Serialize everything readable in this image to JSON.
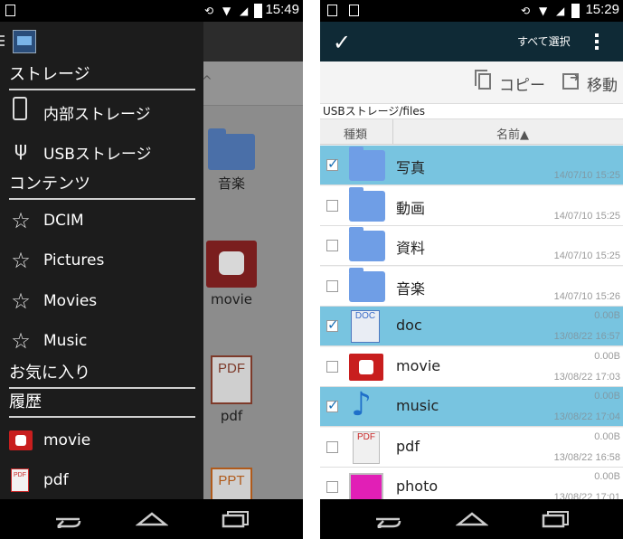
{
  "left": {
    "status": {
      "time": "15:49"
    },
    "drawer": {
      "sections": [
        {
          "title": "ストレージ",
          "items": [
            {
              "label": "内部ストレージ",
              "icon": "phone-icon"
            },
            {
              "label": "USBストレージ",
              "icon": "usb-icon"
            }
          ]
        },
        {
          "title": "コンテンツ",
          "items": [
            {
              "label": "DCIM",
              "icon": "star-icon"
            },
            {
              "label": "Pictures",
              "icon": "star-icon"
            },
            {
              "label": "Movies",
              "icon": "star-icon"
            },
            {
              "label": "Music",
              "icon": "star-icon"
            }
          ]
        },
        {
          "title": "お気に入り",
          "items": []
        },
        {
          "title": "履歴",
          "items": [
            {
              "label": "movie",
              "icon": "film-icon"
            },
            {
              "label": "pdf",
              "icon": "pdf-icon"
            }
          ]
        }
      ],
      "pdf_icon_text": "PDF"
    },
    "background": {
      "chevron": "^",
      "items": [
        {
          "label": "音楽",
          "icon": "folder-icon"
        },
        {
          "label": "movie",
          "icon": "film-icon"
        },
        {
          "label": "pdf",
          "icon": "pdf-icon",
          "icon_text": "PDF"
        },
        {
          "label": "",
          "icon": "ppt-icon",
          "icon_text": "PPT"
        }
      ]
    }
  },
  "right": {
    "status": {
      "time": "15:29"
    },
    "toolbar": {
      "select_all": "すべて選択"
    },
    "actions": {
      "copy": "コピー",
      "move": "移動"
    },
    "path": "USBストレージ/files",
    "columns": {
      "type": "種類",
      "name": "名前▲"
    },
    "files": [
      {
        "name": "写真",
        "type": "folder",
        "size": "",
        "date": "14/07/10 15:25",
        "checked": true
      },
      {
        "name": "動画",
        "type": "folder",
        "size": "",
        "date": "14/07/10 15:25",
        "checked": false
      },
      {
        "name": "資料",
        "type": "folder",
        "size": "",
        "date": "14/07/10 15:25",
        "checked": false
      },
      {
        "name": "音楽",
        "type": "folder",
        "size": "",
        "date": "14/07/10 15:26",
        "checked": false
      },
      {
        "name": "doc",
        "type": "doc",
        "size": "0.00B",
        "date": "13/08/22 16:57",
        "checked": true
      },
      {
        "name": "movie",
        "type": "movie",
        "size": "0.00B",
        "date": "13/08/22 17:03",
        "checked": false
      },
      {
        "name": "music",
        "type": "music",
        "size": "0.00B",
        "date": "13/08/22 17:04",
        "checked": true
      },
      {
        "name": "pdf",
        "type": "pdf",
        "size": "0.00B",
        "date": "13/08/22 16:58",
        "checked": false
      },
      {
        "name": "photo",
        "type": "photo",
        "size": "0.00B",
        "date": "13/08/22 17:01",
        "checked": false
      }
    ],
    "doc_icon_text": "DOC",
    "pdf_icon_text": "PDF"
  },
  "colors": {
    "selected_row": "#78c4e0",
    "toolbar": "#0f2a36",
    "folder": "#6f9ee6",
    "accent_red": "#c81e1e"
  }
}
